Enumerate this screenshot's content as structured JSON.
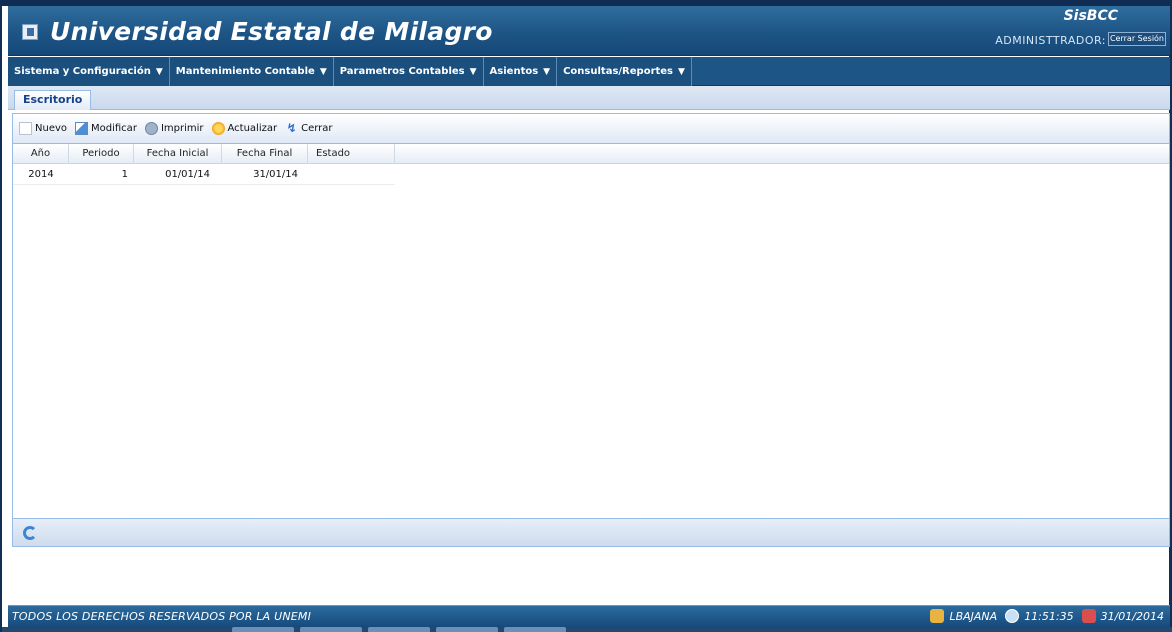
{
  "header": {
    "university": "Universidad Estatal de Milagro",
    "system_name": "SisBCC",
    "user_role": "ADMINISTTRADOR:",
    "logout_label": "Cerrar Sesión"
  },
  "menu": {
    "items": [
      {
        "label": "Sistema y Configuración"
      },
      {
        "label": "Mantenimiento Contable"
      },
      {
        "label": "Parametros Contables"
      },
      {
        "label": "Asientos"
      },
      {
        "label": "Consultas/Reportes"
      }
    ]
  },
  "tabs": {
    "active": "Escritorio"
  },
  "toolbar": {
    "new_label": "Nuevo",
    "edit_label": "Modificar",
    "print_label": "Imprimir",
    "refresh_label": "Actualizar",
    "close_label": "Cerrar"
  },
  "grid": {
    "columns": [
      "Año",
      "Periodo",
      "Fecha Inicial",
      "Fecha Final",
      "Estado"
    ],
    "rows": [
      {
        "anio": "2014",
        "periodo": "1",
        "fecha_inicial": "01/01/14",
        "fecha_final": "31/01/14",
        "estado": ""
      }
    ]
  },
  "footer": {
    "legal": "TODOS LOS DERECHOS RESERVADOS POR LA UNEMI",
    "user": "LBAJANA",
    "time": "11:51:35",
    "date": "31/01/2014"
  },
  "colors": {
    "header_blue": "#1d5586",
    "grid_border": "#99bbe8",
    "title_text": "#ffffff"
  }
}
